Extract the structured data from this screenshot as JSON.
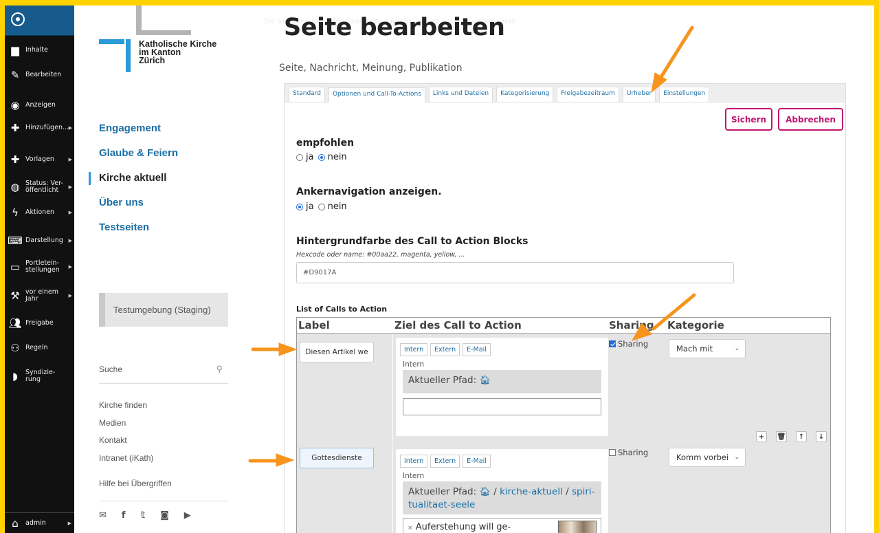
{
  "toolbar": {
    "items": [
      {
        "icon": "folder-icon",
        "label": "Inhalte",
        "has_sub": false
      },
      {
        "icon": "pencil-icon",
        "label": "Bearbeiten",
        "has_sub": false
      },
      {
        "icon": "eye-icon",
        "label": "Anzeigen",
        "has_sub": false
      },
      {
        "icon": "plus-icon",
        "label": "Hinzufügen...",
        "has_sub": true
      },
      {
        "icon": "plus-icon",
        "label": "Vorlagen",
        "has_sub": true
      },
      {
        "icon": "globe-icon",
        "label": "Status: Ver-öffentlicht",
        "has_sub": true
      },
      {
        "icon": "bolt-icon",
        "label": "Aktionen",
        "has_sub": true
      },
      {
        "icon": "display-icon",
        "label": "Darstellung",
        "has_sub": true
      },
      {
        "icon": "portlet-icon",
        "label": "Portletein-stellungen",
        "has_sub": true
      },
      {
        "icon": "wrench-icon",
        "label": "vor einem Jahr",
        "has_sub": true
      },
      {
        "icon": "users-icon",
        "label": "Freigabe",
        "has_sub": false
      },
      {
        "icon": "sitemap-icon",
        "label": "Regeln",
        "has_sub": false
      },
      {
        "icon": "rss-icon",
        "label": "Syndizie-rung",
        "has_sub": false
      }
    ],
    "user": "admin"
  },
  "site": {
    "logo_text": [
      "Katholische Kirche",
      "im Kanton",
      "Zürich"
    ],
    "nav": [
      "Engagement",
      "Glaube & Feiern",
      "Kirche aktuell",
      "Über uns",
      "Testseiten"
    ],
    "active_nav": "Kirche aktuell",
    "staging": "Testumgebung (Staging)",
    "search_placeholder": "Suche",
    "service_links": [
      "Kirche finden",
      "Medien",
      "Kontakt",
      "Intranet (iKath)"
    ],
    "help_link": "Hilfe bei Übergriffen",
    "socials": [
      "mail-icon",
      "facebook-icon",
      "twitter-icon",
      "instagram-icon",
      "youtube-icon"
    ]
  },
  "main": {
    "faint_text": "Sie befinden sich hier: Startseite / Kirche aktuell / spiritualitaet-seele",
    "title": "Seite bearbeiten",
    "subtitle": "Seite, Nachricht, Meinung, Publikation",
    "tabs": [
      "Standard",
      "Optionen und Call-To-Actions",
      "Links und Dateien",
      "Kategorisierung",
      "Freigabezeitraum",
      "Urheber",
      "Einstellungen"
    ],
    "active_tab": "Optionen und Call-To-Actions",
    "save": "Sichern",
    "cancel": "Abbrechen",
    "recommended": {
      "label": "empfohlen",
      "options": [
        "ja",
        "nein"
      ],
      "selected": "nein"
    },
    "anchor_nav": {
      "label": "Ankernavigation anzeigen.",
      "options": [
        "ja",
        "nein"
      ],
      "selected": "ja"
    },
    "bgcolor": {
      "label": "Hintergrundfarbe des Call to Action Blocks",
      "hint": "Hexcode oder name: #00aa22, magenta, yellow, ...",
      "value": "#D9017A"
    },
    "cta_list": {
      "title": "List of Calls to Action",
      "headers": [
        "Label",
        "Ziel des Call to Action",
        "Sharing",
        "Kategorie"
      ],
      "rows": [
        {
          "label": "Diesen Artikel we",
          "target_tabs": [
            "Intern",
            "Extern",
            "E-Mail"
          ],
          "intern_label": "Intern",
          "path_prefix": "Aktueller Pfad:",
          "path": [],
          "sharing_label": "Sharing",
          "sharing": true,
          "category": "Mach mit"
        },
        {
          "label": "Gottesdienste",
          "target_tabs": [
            "Intern",
            "Extern",
            "E-Mail"
          ],
          "intern_label": "Intern",
          "path_prefix": "Aktueller Pfad:",
          "path": [
            "kirche-aktuell",
            "spiri-tualitaet-seele"
          ],
          "reference": "Auferstehung will ge-",
          "sharing_label": "Sharing",
          "sharing": false,
          "category": "Komm vorbei"
        }
      ],
      "row_buttons": [
        "add",
        "delete",
        "up",
        "down"
      ]
    }
  },
  "colors": {
    "accent": "#c0186f",
    "link": "#1c6fa6",
    "frame": "#ffd200",
    "arrow": "#f7941d"
  }
}
